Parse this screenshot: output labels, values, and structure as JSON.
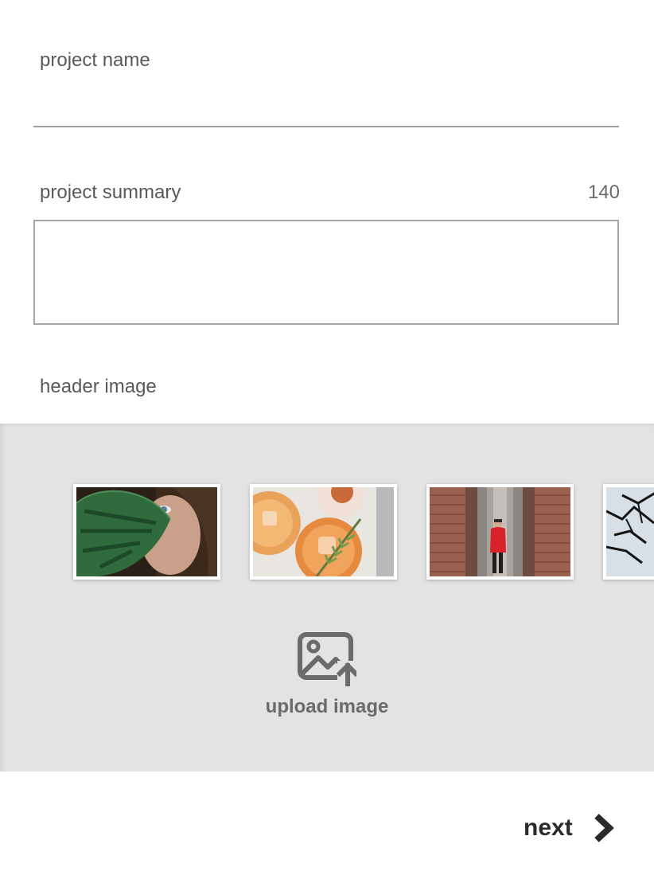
{
  "form": {
    "project_name_label": "project name",
    "project_name_value": "",
    "project_summary_label": "project summary",
    "project_summary_value": "",
    "summary_char_counter": "140",
    "header_image_label": "header image"
  },
  "gallery": {
    "thumbnails": [
      {
        "icon": "portrait-with-monstera-leaf"
      },
      {
        "icon": "cocktail-glasses"
      },
      {
        "icon": "person-in-red-coat-brick-arches"
      },
      {
        "icon": "cracked-abstract-pattern"
      }
    ],
    "upload_label": "upload image",
    "upload_icon": "image-upload-icon"
  },
  "footer": {
    "next_label": "next",
    "next_icon": "chevron-right-icon"
  },
  "colors": {
    "gallery_bg": "#e3e3e3",
    "label_text": "#595959",
    "upload_text": "#6b6b6b",
    "next_text": "#2b2b2b",
    "accent_red": "#d8232a"
  }
}
